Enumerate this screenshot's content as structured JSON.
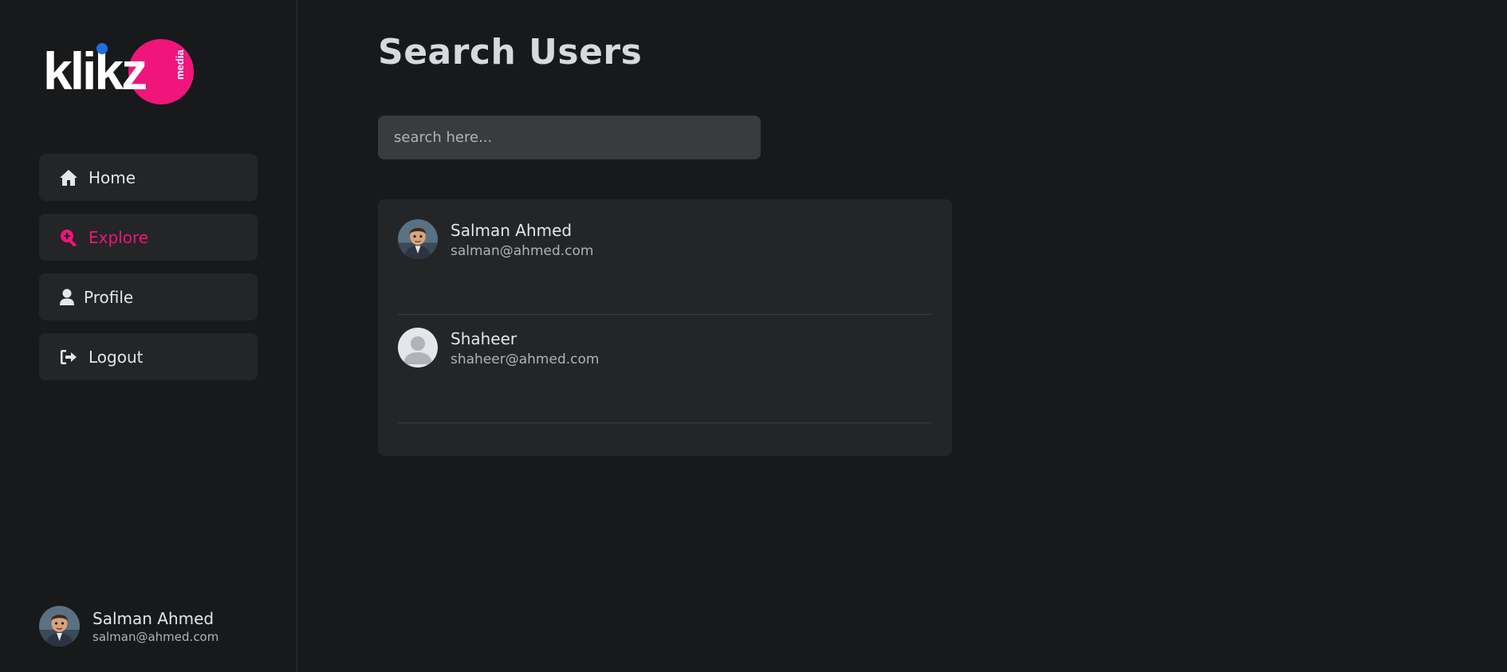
{
  "brand": {
    "wordmark": "klikz",
    "sub": "media",
    "accent": "#f0157b",
    "dot_color": "#1f6fe0"
  },
  "sidebar": {
    "items": [
      {
        "label": "Home",
        "icon": "home-icon",
        "active": false
      },
      {
        "label": "Explore",
        "icon": "search-plus-icon",
        "active": true
      },
      {
        "label": "Profile",
        "icon": "user-icon",
        "active": false
      },
      {
        "label": "Logout",
        "icon": "logout-icon",
        "active": false
      }
    ],
    "current_user": {
      "name": "Salman Ahmed",
      "email": "salman@ahmed.com"
    }
  },
  "main": {
    "title": "Search Users",
    "search": {
      "placeholder": "search here...",
      "value": ""
    },
    "results": [
      {
        "name": "Salman Ahmed",
        "email": "salman@ahmed.com",
        "avatar": "cartoon-avatar"
      },
      {
        "name": "Shaheer",
        "email": "shaheer@ahmed.com",
        "avatar": "default-avatar"
      }
    ]
  }
}
